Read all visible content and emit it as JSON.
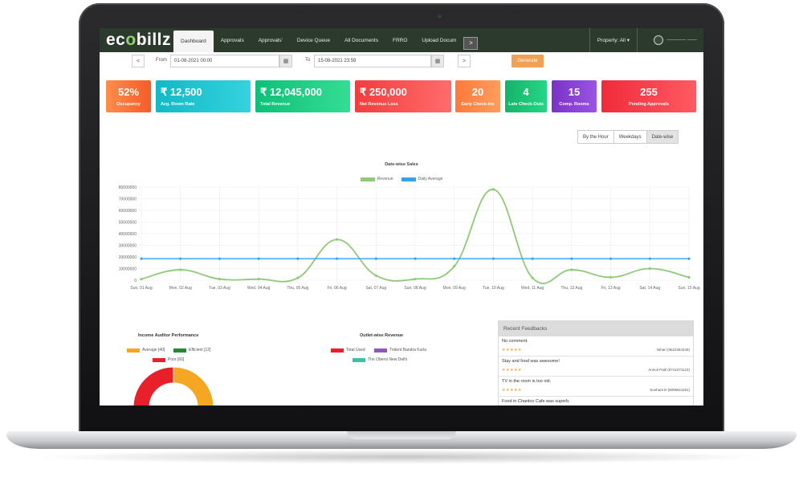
{
  "app": {
    "logo_prefix": "ec",
    "logo_oo": "o",
    "logo_suffix": "billz"
  },
  "nav": {
    "tabs": [
      {
        "label": "Dashboard",
        "active": true
      },
      {
        "label": "Approvals",
        "active": false
      },
      {
        "label": "Approvals'",
        "active": false
      },
      {
        "label": "Device Queue",
        "active": false
      },
      {
        "label": "All Documents",
        "active": false
      },
      {
        "label": "FRRO",
        "active": false
      },
      {
        "label": "Upload Docum",
        "active": false
      }
    ],
    "more_label": ">",
    "property_label": "Property: All ▾",
    "user_label": "———— ——"
  },
  "filters": {
    "prev_label": "<",
    "from_label": "From",
    "from_value": "01-08-2021 00:00",
    "to_label": "To",
    "to_value": "15-08-2021 23:59",
    "next_label": ">",
    "generate_label": "Generate",
    "calendar_icon": "▦"
  },
  "kpis": [
    {
      "value": "52%",
      "label": "Occupancy",
      "color1": "#ff8d4a",
      "color2": "#f45c2a"
    },
    {
      "value": "₹ 12,500",
      "label": "Avg. Room Rate",
      "color1": "#13b9c6",
      "color2": "#35d2df"
    },
    {
      "value": "₹ 12,045,000",
      "label": "Total Revenue",
      "color1": "#0fbf78",
      "color2": "#35dd94"
    },
    {
      "value": "₹ 250,000",
      "label": "Net Revenue Loss",
      "color1": "#f33d3d",
      "color2": "#ff6c6c"
    },
    {
      "value": "20",
      "label": "Early Check-ins",
      "color1": "#ff7a3a",
      "color2": "#ff9d5e"
    },
    {
      "value": "4",
      "label": "Late Check-Outs",
      "color1": "#13b46a",
      "color2": "#28d586"
    },
    {
      "value": "15",
      "label": "Comp. Rooms",
      "color1": "#7a32c6",
      "color2": "#9a55e3"
    },
    {
      "value": "255",
      "label": "Pending Approvals",
      "color1": "#f02b3b",
      "color2": "#ff5a63"
    }
  ],
  "view_toggle": {
    "options": [
      "By the Hour",
      "Weekdays",
      "Date-wise"
    ],
    "active": "Date-wise"
  },
  "chart_data": {
    "type": "line",
    "title": "Date-wise Sales",
    "categories": [
      "Sun, 01 Aug",
      "Mon, 02 Aug",
      "Tue, 03 Aug",
      "Wed, 04 Aug",
      "Thu, 05 Aug",
      "Fri, 06 Aug",
      "Sat, 07 Aug",
      "Sun, 08 Aug",
      "Mon, 09 Aug",
      "Tue, 10 Aug",
      "Wed, 11 Aug",
      "Thu, 12 Aug",
      "Fri, 13 Aug",
      "Sat, 14 Aug",
      "Sun, 15 Aug"
    ],
    "series": [
      {
        "name": "Revenue",
        "color": "#8fc97a",
        "values": [
          1000000,
          9000000,
          1000000,
          1000000,
          2000000,
          35000000,
          4000000,
          1000000,
          12000000,
          78000000,
          2000000,
          9000000,
          2500000,
          10000000,
          2500000
        ]
      },
      {
        "name": "Daily Average",
        "color": "#36a2eb",
        "values": [
          18500000,
          18500000,
          18500000,
          18500000,
          18500000,
          18500000,
          18500000,
          18500000,
          18500000,
          18500000,
          18500000,
          18500000,
          18500000,
          18500000,
          18500000
        ]
      }
    ],
    "yticks": [
      "80000000",
      "70000000",
      "60000000",
      "50000000",
      "40000000",
      "30000000",
      "20000000",
      "10000000",
      "0"
    ],
    "ylim": [
      0,
      80000000
    ],
    "grid": true,
    "legend": "top-center"
  },
  "auditor": {
    "title": "Income Auditor Performance",
    "legend": [
      {
        "label": "Average [40]",
        "color": "#f5a623"
      },
      {
        "label": "Efficient [12]",
        "color": "#1e8a32"
      },
      {
        "label": "Poor [60]",
        "color": "#e8202a"
      }
    ]
  },
  "outlet": {
    "title": "Outlet-wise Revenue",
    "legend": [
      {
        "label": "Total Used",
        "color": "#e8202a"
      },
      {
        "label": "Trident Bandra Kurla",
        "color": "#8e57b8"
      },
      {
        "label": "The Oberoi New Delhi",
        "color": "#3cc0a6"
      }
    ]
  },
  "feedbacks": {
    "title": "Recent Feedbacks",
    "items": [
      {
        "text": "No comment.",
        "stars": "★★★★★",
        "user": "Nihari (9622384448)"
      },
      {
        "text": "Stay and food was awesome!",
        "stars": "★★★★★",
        "user": "Anmol Patil (9741071122)"
      },
      {
        "text": "TV in the room is too old.",
        "stars": "★★★★★",
        "user": "Sushant D (8095811191)"
      },
      {
        "text": "Food in Chantco Cafe was superb.",
        "stars": "",
        "user": ""
      }
    ]
  }
}
